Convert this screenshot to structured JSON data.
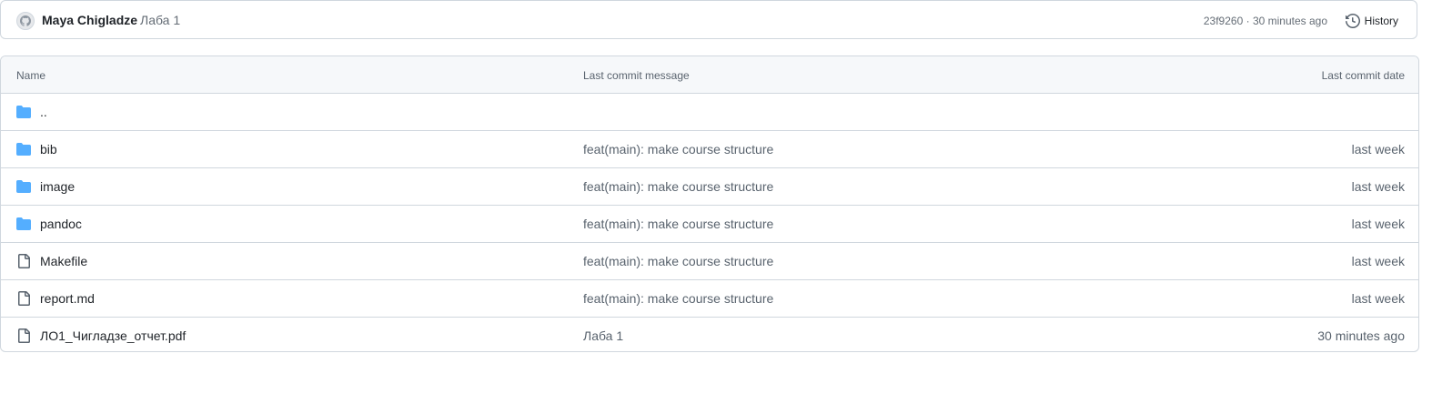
{
  "commit_bar": {
    "author": "Maya Chigladze",
    "message": "Лаба 1",
    "sha": "23f9260",
    "separator": " · ",
    "time": "30 minutes ago",
    "history_label": "History",
    "avatar_icon": "github-avatar-icon",
    "history_icon": "history-clock-icon"
  },
  "table": {
    "headers": {
      "name": "Name",
      "message": "Last commit message",
      "date": "Last commit date"
    },
    "rows": [
      {
        "type": "folder",
        "icon": "folder-icon",
        "name": "..",
        "message": "",
        "date": ""
      },
      {
        "type": "folder",
        "icon": "folder-icon",
        "name": "bib",
        "message": "feat(main): make course structure",
        "date": "last week"
      },
      {
        "type": "folder",
        "icon": "folder-icon",
        "name": "image",
        "message": "feat(main): make course structure",
        "date": "last week"
      },
      {
        "type": "folder",
        "icon": "folder-icon",
        "name": "pandoc",
        "message": "feat(main): make course structure",
        "date": "last week"
      },
      {
        "type": "file",
        "icon": "file-icon",
        "name": "Makefile",
        "message": "feat(main): make course structure",
        "date": "last week"
      },
      {
        "type": "file",
        "icon": "file-icon",
        "name": "report.md",
        "message": "feat(main): make course structure",
        "date": "last week"
      },
      {
        "type": "file",
        "icon": "file-icon",
        "name": "ЛО1_Чигладзе_отчет.pdf",
        "message": "Лаба 1",
        "date": "30 minutes ago"
      }
    ]
  },
  "colors": {
    "folder": "#54aeff",
    "file_stroke": "#59636e",
    "border": "#d0d7de",
    "header_bg": "#f6f8fa",
    "muted_text": "#59636e"
  }
}
